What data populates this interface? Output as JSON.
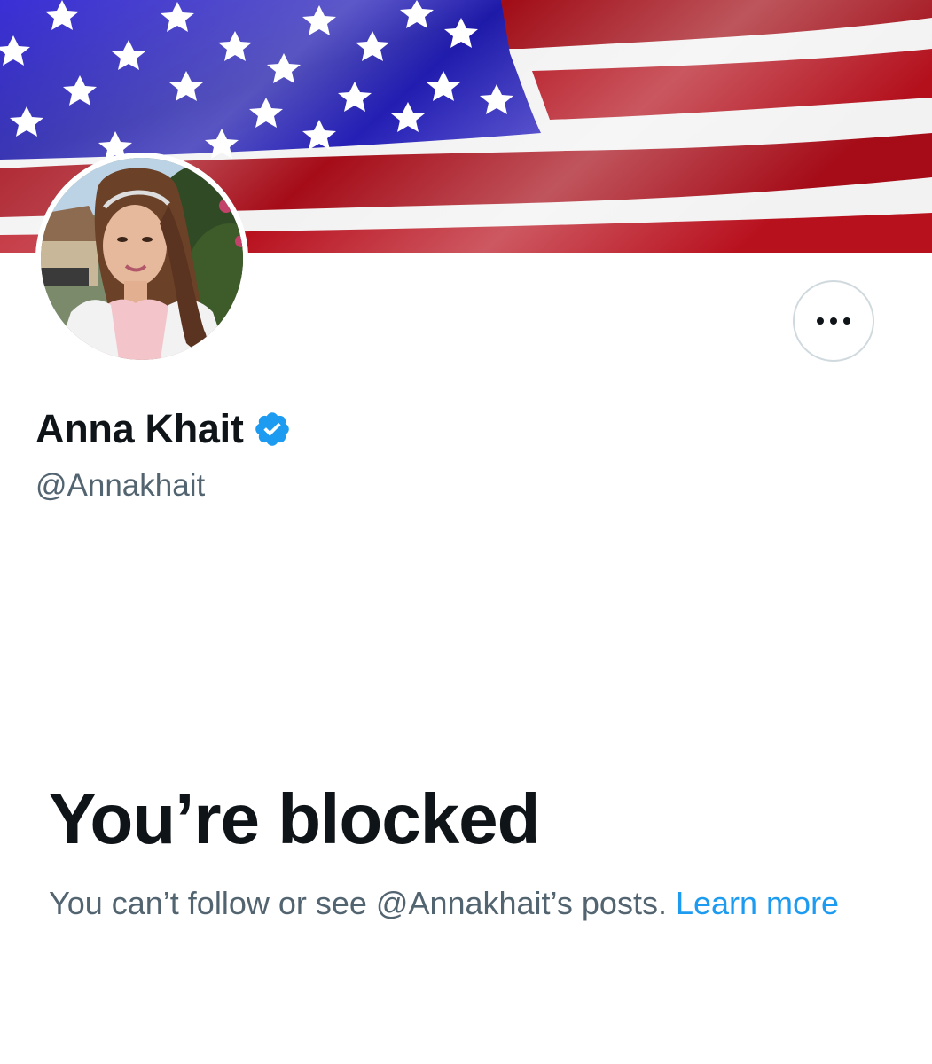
{
  "profile": {
    "display_name": "Anna Khait",
    "handle": "@Annakhait",
    "verified": true,
    "banner_image": "american-flag",
    "avatar_image": "profile-photo"
  },
  "actions": {
    "more_icon": "more-horizontal-icon"
  },
  "blocked": {
    "title": "You’re blocked",
    "message": "You can’t follow or see @Annakhait’s posts.",
    "learn_more_label": "Learn more"
  },
  "colors": {
    "text_primary": "#0f1419",
    "text_secondary": "#536471",
    "link": "#1d9bf0",
    "verified_badge": "#1d9bf0",
    "border": "#cfd9de"
  }
}
